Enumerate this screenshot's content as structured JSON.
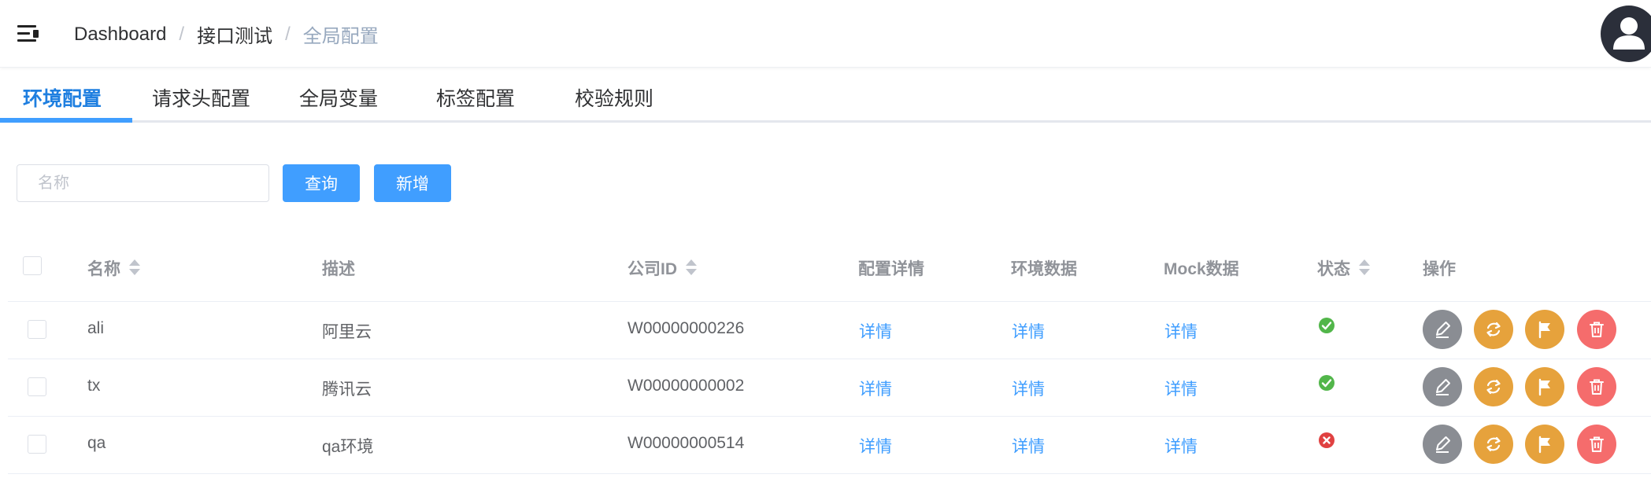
{
  "header": {
    "breadcrumb": [
      "Dashboard",
      "接口测试",
      "全局配置"
    ],
    "separator": "/"
  },
  "tabs": [
    "环境配置",
    "请求头配置",
    "全局变量",
    "标签配置",
    "校验规则"
  ],
  "active_tab": "环境配置",
  "filter": {
    "name_placeholder": "名称",
    "query_label": "查询",
    "add_label": "新增"
  },
  "table": {
    "columns": {
      "name": "名称",
      "desc": "描述",
      "company_id": "公司ID",
      "config_detail": "配置详情",
      "env_data": "环境数据",
      "mock_data": "Mock数据",
      "status": "状态",
      "actions": "操作"
    },
    "rows": [
      {
        "name": "ali",
        "desc": "阿里云",
        "company_id": "W00000000226",
        "config_detail": "详情",
        "env_data": "详情",
        "mock_data": "详情",
        "status": "enabled"
      },
      {
        "name": "tx",
        "desc": "腾讯云",
        "company_id": "W00000000002",
        "config_detail": "详情",
        "env_data": "详情",
        "mock_data": "详情",
        "status": "enabled"
      },
      {
        "name": "qa",
        "desc": "qa环境",
        "company_id": "W00000000514",
        "config_detail": "详情",
        "env_data": "详情",
        "mock_data": "详情",
        "status": "disabled"
      }
    ]
  },
  "colors": {
    "primary": "#409eff",
    "success": "#52b64a",
    "danger": "#f56c6c",
    "warning": "#e6a23c",
    "info": "#8a8d93"
  },
  "icons": {
    "menu": "hamburger-fold-icon",
    "avatar": "user-icon",
    "edit": "pencil-icon",
    "sync": "refresh-icon",
    "flag": "flag-icon",
    "delete": "trash-icon",
    "status_ok": "check-circle-icon",
    "status_err": "x-circle-icon"
  }
}
